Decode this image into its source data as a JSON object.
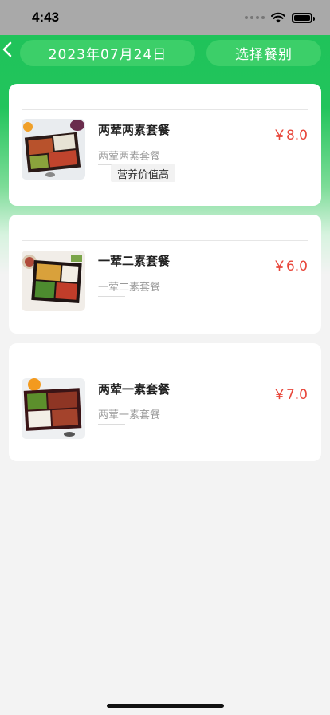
{
  "status": {
    "time": "4:43"
  },
  "header": {
    "date": "2023年07月24日",
    "meal_selector": "选择餐别",
    "accent": "#22c45c"
  },
  "meals": [
    {
      "name": "两荤两素套餐",
      "desc": "两荤两素套餐",
      "price": "￥8.0",
      "tag": "营养价值高"
    },
    {
      "name": "一荤二素套餐",
      "desc": "一荤二素套餐",
      "price": "￥6.0"
    },
    {
      "name": "两荤一素套餐",
      "desc": "两荤一素套餐",
      "price": "￥7.0"
    }
  ]
}
